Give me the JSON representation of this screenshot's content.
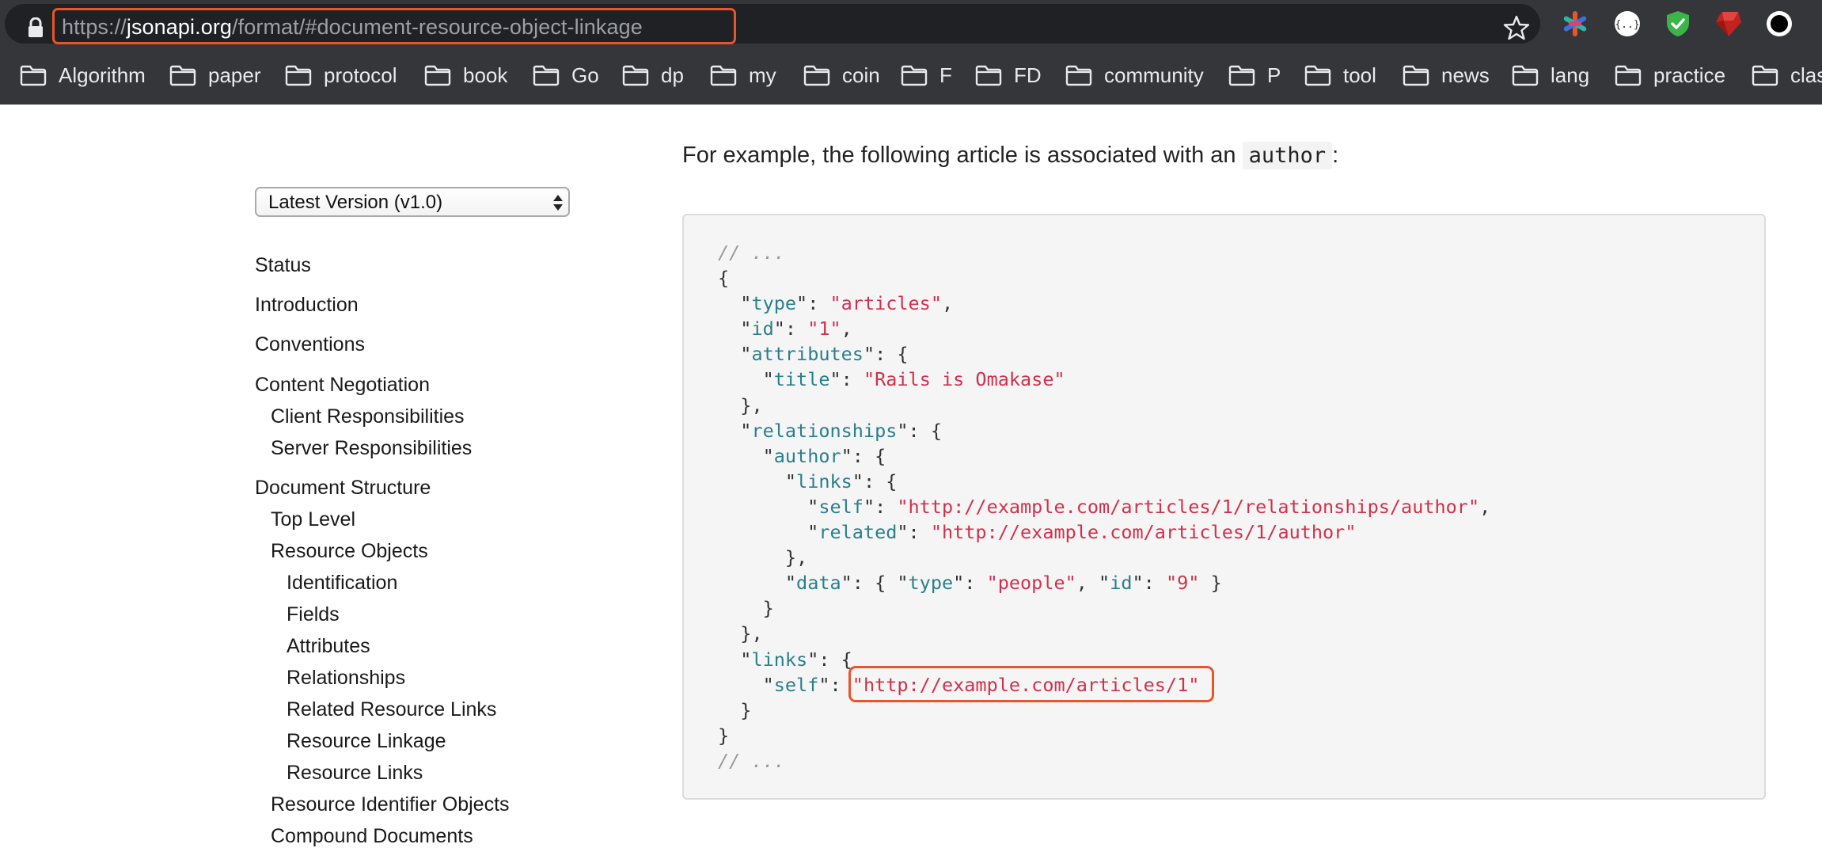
{
  "browser": {
    "url": {
      "scheme": "https://",
      "host": "jsonapi.org",
      "path": "/format/#document-resource-object-linkage"
    },
    "icons": {
      "lock": "lock-icon",
      "bookmark_star": "star-icon",
      "extensions": [
        "colorful-asterisk-extension-icon",
        "json-braces-extension-icon",
        "green-shield-extension-icon",
        "ruby-gem-extension-icon",
        "black-circle-extension-icon"
      ]
    },
    "bookmarks": [
      "Algorithm",
      "paper",
      "protocol",
      "book",
      "Go",
      "dp",
      "my",
      "coin",
      "F",
      "FD",
      "community",
      "P",
      "tool",
      "news",
      "lang",
      "practice",
      "clas"
    ]
  },
  "sidebar": {
    "version_select": {
      "selected": "Latest Version (v1.0)"
    },
    "nav": [
      {
        "label": "Status",
        "level": 0
      },
      {
        "label": "Introduction",
        "level": 0
      },
      {
        "label": "Conventions",
        "level": 0
      },
      {
        "label": "Content Negotiation",
        "level": 0
      },
      {
        "label": "Client Responsibilities",
        "level": 1
      },
      {
        "label": "Server Responsibilities",
        "level": 1
      },
      {
        "label": "Document Structure",
        "level": 0
      },
      {
        "label": "Top Level",
        "level": 1
      },
      {
        "label": "Resource Objects",
        "level": 1
      },
      {
        "label": "Identification",
        "level": 2
      },
      {
        "label": "Fields",
        "level": 2
      },
      {
        "label": "Attributes",
        "level": 2
      },
      {
        "label": "Relationships",
        "level": 2
      },
      {
        "label": "Related Resource Links",
        "level": 2
      },
      {
        "label": "Resource Linkage",
        "level": 2
      },
      {
        "label": "Resource Links",
        "level": 2
      },
      {
        "label": "Resource Identifier Objects",
        "level": 1
      },
      {
        "label": "Compound Documents",
        "level": 1
      }
    ]
  },
  "content": {
    "intro_text": "For example, the following article is associated with an",
    "intro_code": "author",
    "intro_suffix": ":",
    "code_lines": [
      [
        {
          "t": "c",
          "v": "// ..."
        }
      ],
      [
        {
          "t": "p",
          "v": "{"
        }
      ],
      [
        {
          "t": "p",
          "v": "  \""
        },
        {
          "t": "k",
          "v": "type"
        },
        {
          "t": "p",
          "v": "\": "
        },
        {
          "t": "s",
          "v": "\"articles\""
        },
        {
          "t": "p",
          "v": ","
        }
      ],
      [
        {
          "t": "p",
          "v": "  \""
        },
        {
          "t": "k",
          "v": "id"
        },
        {
          "t": "p",
          "v": "\": "
        },
        {
          "t": "s",
          "v": "\"1\""
        },
        {
          "t": "p",
          "v": ","
        }
      ],
      [
        {
          "t": "p",
          "v": "  \""
        },
        {
          "t": "k",
          "v": "attributes"
        },
        {
          "t": "p",
          "v": "\": {"
        }
      ],
      [
        {
          "t": "p",
          "v": "    \""
        },
        {
          "t": "k",
          "v": "title"
        },
        {
          "t": "p",
          "v": "\": "
        },
        {
          "t": "s",
          "v": "\"Rails is Omakase\""
        }
      ],
      [
        {
          "t": "p",
          "v": "  },"
        }
      ],
      [
        {
          "t": "p",
          "v": "  \""
        },
        {
          "t": "k",
          "v": "relationships"
        },
        {
          "t": "p",
          "v": "\": {"
        }
      ],
      [
        {
          "t": "p",
          "v": "    \""
        },
        {
          "t": "k",
          "v": "author"
        },
        {
          "t": "p",
          "v": "\": {"
        }
      ],
      [
        {
          "t": "p",
          "v": "      \""
        },
        {
          "t": "k",
          "v": "links"
        },
        {
          "t": "p",
          "v": "\": {"
        }
      ],
      [
        {
          "t": "p",
          "v": "        \""
        },
        {
          "t": "k",
          "v": "self"
        },
        {
          "t": "p",
          "v": "\": "
        },
        {
          "t": "s",
          "v": "\"http://example.com/articles/1/relationships/author\""
        },
        {
          "t": "p",
          "v": ","
        }
      ],
      [
        {
          "t": "p",
          "v": "        \""
        },
        {
          "t": "k",
          "v": "related"
        },
        {
          "t": "p",
          "v": "\": "
        },
        {
          "t": "s",
          "v": "\"http://example.com/articles/1/author\""
        }
      ],
      [
        {
          "t": "p",
          "v": "      },"
        }
      ],
      [
        {
          "t": "p",
          "v": "      \""
        },
        {
          "t": "k",
          "v": "data"
        },
        {
          "t": "p",
          "v": "\": { \""
        },
        {
          "t": "k",
          "v": "type"
        },
        {
          "t": "p",
          "v": "\": "
        },
        {
          "t": "s",
          "v": "\"people\""
        },
        {
          "t": "p",
          "v": ", \""
        },
        {
          "t": "k",
          "v": "id"
        },
        {
          "t": "p",
          "v": "\": "
        },
        {
          "t": "s",
          "v": "\"9\""
        },
        {
          "t": "p",
          "v": " }"
        }
      ],
      [
        {
          "t": "p",
          "v": "    }"
        }
      ],
      [
        {
          "t": "p",
          "v": "  },"
        }
      ],
      [
        {
          "t": "p",
          "v": "  \""
        },
        {
          "t": "k",
          "v": "links"
        },
        {
          "t": "p",
          "v": "\": {"
        }
      ],
      [
        {
          "t": "p",
          "v": "    \""
        },
        {
          "t": "k",
          "v": "self"
        },
        {
          "t": "p",
          "v": "\": "
        },
        {
          "t": "s",
          "v": "\"http://example.com/articles/1\""
        }
      ],
      [
        {
          "t": "p",
          "v": "  }"
        }
      ],
      [
        {
          "t": "p",
          "v": "}"
        }
      ],
      [
        {
          "t": "c",
          "v": "// ..."
        }
      ]
    ]
  },
  "colors": {
    "chrome_dark": "#35363a",
    "omnibox": "#202124",
    "annotation_highlight": "#e8542c",
    "code_key": "#2a7f8a",
    "code_string": "#d0314c",
    "code_comment": "#999999"
  }
}
